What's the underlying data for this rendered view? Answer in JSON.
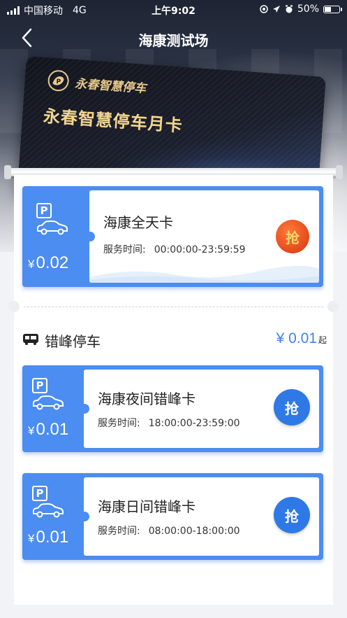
{
  "status_bar": {
    "carrier": "中国移动",
    "network": "4G",
    "time": "上午9:02",
    "battery": "50%",
    "battery_level": 0.5
  },
  "nav": {
    "title": "海康测试场"
  },
  "hero_card": {
    "brand": "永春智慧停车",
    "card_name": "永春智慧停车月卡"
  },
  "featured_ticket": {
    "title": "海康全天卡",
    "service_label": "服务时间:",
    "service_time": "00:00:00-23:59:59",
    "yen": "¥",
    "price": "0.02",
    "grab_label": "抢",
    "button_color": "#e94f1f"
  },
  "offpeak_section": {
    "title": "错峰停车",
    "yen": "¥",
    "price_from": "0.01",
    "from_suffix": "起",
    "tickets": [
      {
        "title": "海康夜间错峰卡",
        "service_label": "服务时间:",
        "service_time": "18:00:00-23:59:00",
        "yen": "¥",
        "price": "0.01",
        "grab_label": "抢"
      },
      {
        "title": "海康日间错峰卡",
        "service_label": "服务时间:",
        "service_time": "08:00:00-18:00:00",
        "yen": "¥",
        "price": "0.01",
        "grab_label": "抢"
      }
    ],
    "button_color": "#2f79e6"
  },
  "colors": {
    "ticket_blue": "#4b8df0",
    "price_blue": "#3e82ec"
  }
}
